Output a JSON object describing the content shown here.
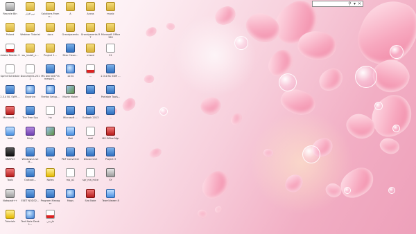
{
  "desktop": {
    "icons": [
      {
        "label": "Recycle Bin",
        "icon": "recycle-bin-icon"
      },
      {
        "label": "نرم افزار",
        "icon": "folder-icon"
      },
      {
        "label": "Solutions Frame...",
        "icon": "folder-icon"
      },
      {
        "label": "A",
        "icon": "folder-icon"
      },
      {
        "label": "Accas",
        "icon": "folder-icon"
      },
      {
        "label": "music",
        "icon": "folder-icon"
      },
      {
        "label": "Poland",
        "icon": "folder-icon"
      },
      {
        "label": "Webinar Tutorial",
        "icon": "folder-icon"
      },
      {
        "label": "docs",
        "icon": "folder-icon"
      },
      {
        "label": "Grandparents",
        "icon": "folder-icon"
      },
      {
        "label": "Grandparents RT",
        "icon": "folder-icon"
      },
      {
        "label": "Microsoft Office 365",
        "icon": "folder-icon"
      },
      {
        "label": "Adobe Reader 9",
        "icon": "pdf-icon"
      },
      {
        "label": "ws_install_n...",
        "icon": "folder-icon"
      },
      {
        "label": "Project 1...",
        "icon": "folder-icon"
      },
      {
        "label": "Disk Clean...",
        "icon": "app-icon"
      },
      {
        "label": "mixed",
        "icon": "folder-icon"
      },
      {
        "label": "01",
        "icon": "doc-icon"
      },
      {
        "label": "Sprint Schedule",
        "icon": "doc-icon"
      },
      {
        "label": "Documents 2011",
        "icon": "doc-icon"
      },
      {
        "label": "MS Dot Net Framework...",
        "icon": "app-icon"
      },
      {
        "label": "1234",
        "icon": "globe-icon"
      },
      {
        "label": "...",
        "icon": "pdf-icon"
      },
      {
        "label": "2.3.4 BC SW9 ...",
        "icon": "app-icon"
      },
      {
        "label": "2.3.4 BC SW9 ...",
        "icon": "app-icon"
      },
      {
        "label": "Skydrive",
        "icon": "globe-icon"
      },
      {
        "label": "Firefox Setup...",
        "icon": "globe-icon"
      },
      {
        "label": "Movie Maker",
        "icon": "img-icon"
      },
      {
        "label": "...",
        "icon": "app-icon"
      },
      {
        "label": "Portable Tools...",
        "icon": "app-icon"
      },
      {
        "label": "Microsoft ...",
        "icon": "red-icon"
      },
      {
        "label": "The Free Spy",
        "icon": "app-icon"
      },
      {
        "label": "ha",
        "icon": "doc-icon"
      },
      {
        "label": "Microsoft ...",
        "icon": "app-icon"
      },
      {
        "label": "Outlook 2013",
        "icon": "app-icon"
      },
      {
        "label": "...",
        "icon": "app-icon"
      },
      {
        "label": "Intel",
        "icon": "blue2-icon"
      },
      {
        "label": "Ninja",
        "icon": "purple-icon"
      },
      {
        "label": "...",
        "icon": "img-icon"
      },
      {
        "label": "Mall",
        "icon": "blue2-icon"
      },
      {
        "label": "mail",
        "icon": "doc-icon"
      },
      {
        "label": "MS Office Mgr",
        "icon": "red-icon"
      },
      {
        "label": "SNAP23",
        "icon": "dark-icon"
      },
      {
        "label": "Windows Live M...",
        "icon": "app-icon"
      },
      {
        "label": "Sky",
        "icon": "app-icon"
      },
      {
        "label": "PDF Converter",
        "icon": "app-icon"
      },
      {
        "label": "Disconnect",
        "icon": "app-icon"
      },
      {
        "label": "Project 3",
        "icon": "app-icon"
      },
      {
        "label": "Tools",
        "icon": "red-icon"
      },
      {
        "label": "Outlook...",
        "icon": "app-icon"
      },
      {
        "label": "Notes",
        "icon": "yellow-icon"
      },
      {
        "label": "mp_o1",
        "icon": "doc-icon"
      },
      {
        "label": "spr_ma_mice",
        "icon": "doc-icon"
      },
      {
        "label": "SY",
        "icon": "gray-icon"
      },
      {
        "label": "Notepad++",
        "icon": "gray-icon"
      },
      {
        "label": "ESET NOD32...",
        "icon": "app-icon"
      },
      {
        "label": "Program Manager",
        "icon": "app-icon"
      },
      {
        "label": "Maps",
        "icon": "globe-icon"
      },
      {
        "label": "Sea Note",
        "icon": "red-icon"
      },
      {
        "label": "TeamViewer 8",
        "icon": "blue2-icon"
      },
      {
        "label": "Tutorials",
        "icon": "yellow-icon"
      },
      {
        "label": "Text Note Deskt...",
        "icon": "globe-icon"
      },
      {
        "label": "فارسی",
        "icon": "pdf-icon"
      }
    ]
  },
  "searchbar": {
    "value": "",
    "placeholder": ""
  },
  "colors": {
    "accent": "#f2aec4",
    "petal": "#ef7f9f",
    "text": "#333333"
  }
}
